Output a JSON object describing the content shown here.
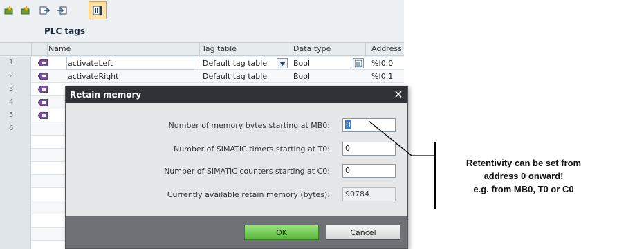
{
  "toolbar": {
    "buttons": [
      {
        "icon": "add-tag-icon"
      },
      {
        "icon": "insert-row-icon"
      },
      {
        "icon": "export-icon"
      },
      {
        "icon": "import-icon"
      },
      {
        "icon": "retain-memory-icon"
      }
    ]
  },
  "editor": {
    "title": "PLC tags",
    "columns": {
      "name": "Name",
      "tag_table": "Tag table",
      "data_type": "Data type",
      "address": "Address"
    },
    "rows": [
      {
        "num": "1",
        "name": "activateLeft",
        "tag_table": "Default tag table",
        "data_type": "Bool",
        "address": "%I0.0"
      },
      {
        "num": "2",
        "name": "activateRight",
        "tag_table": "Default tag table",
        "data_type": "Bool",
        "address": "%I0.1"
      },
      {
        "num": "3"
      },
      {
        "num": "4"
      },
      {
        "num": "5"
      },
      {
        "num": "6"
      }
    ]
  },
  "dialog": {
    "title": "Retain memory",
    "fields": [
      {
        "label": "Number of memory bytes starting at MB0:",
        "value": "0"
      },
      {
        "label": "Number of SIMATIC timers starting at T0:",
        "value": "0"
      },
      {
        "label": "Number of SIMATIC counters starting at C0:",
        "value": "0"
      },
      {
        "label": "Currently available retain memory (bytes):",
        "value": "90784"
      }
    ],
    "ok_label": "OK",
    "cancel_label": "Cancel",
    "close_glyph": "✕"
  },
  "callout": {
    "lines": [
      "Retentivity can be set from",
      "address 0 onward!",
      "e.g. from MB0, T0 or C0"
    ]
  },
  "colors": {
    "dialog_titlebar": "#2f3338",
    "ok_button": "#55b83a",
    "selection": "#3a78c9",
    "retain_button_highlight": "#ffe3a8"
  }
}
